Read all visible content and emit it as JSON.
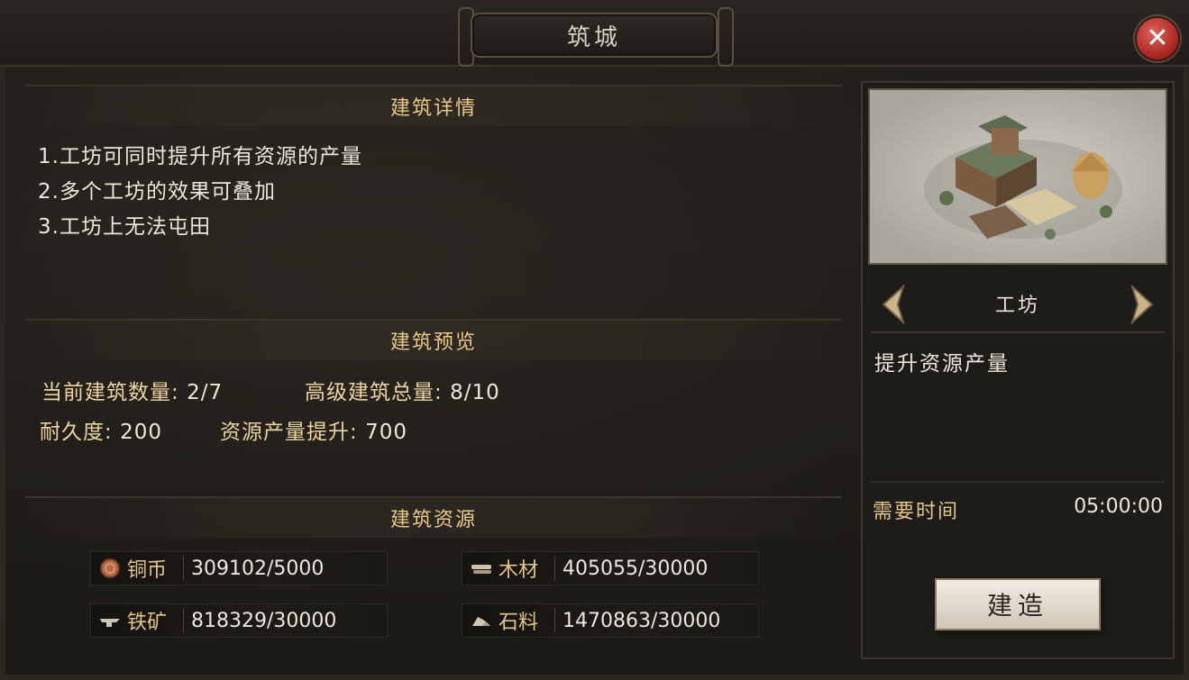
{
  "window": {
    "title": "筑城",
    "close_label": "✕"
  },
  "details": {
    "heading": "建筑详情",
    "lines": [
      "1.工坊可同时提升所有资源的产量",
      "2.多个工坊的效果可叠加",
      "3.工坊上无法屯田"
    ]
  },
  "preview": {
    "heading": "建筑预览",
    "current_count_label": "当前建筑数量:",
    "current_count_value": "2/7",
    "advanced_total_label": "高级建筑总量:",
    "advanced_total_value": "8/10",
    "durability_label": "耐久度:",
    "durability_value": "200",
    "resource_boost_label": "资源产量提升:",
    "resource_boost_value": "700"
  },
  "resources": {
    "heading": "建筑资源",
    "items": [
      {
        "name": "铜币",
        "value": "309102/5000",
        "icon": "coin-icon"
      },
      {
        "name": "木材",
        "value": "405055/30000",
        "icon": "wood-icon"
      },
      {
        "name": "铁矿",
        "value": "818329/30000",
        "icon": "iron-icon"
      },
      {
        "name": "石料",
        "value": "1470863/30000",
        "icon": "stone-icon"
      }
    ]
  },
  "building": {
    "name": "工坊",
    "description": "提升资源产量",
    "time_label": "需要时间",
    "time_value": "05:00:00",
    "build_label": "建造"
  },
  "colors": {
    "accent_gold": "#e9c98a",
    "close_red": "#c33a33",
    "panel_bg": "#1e1c19"
  }
}
